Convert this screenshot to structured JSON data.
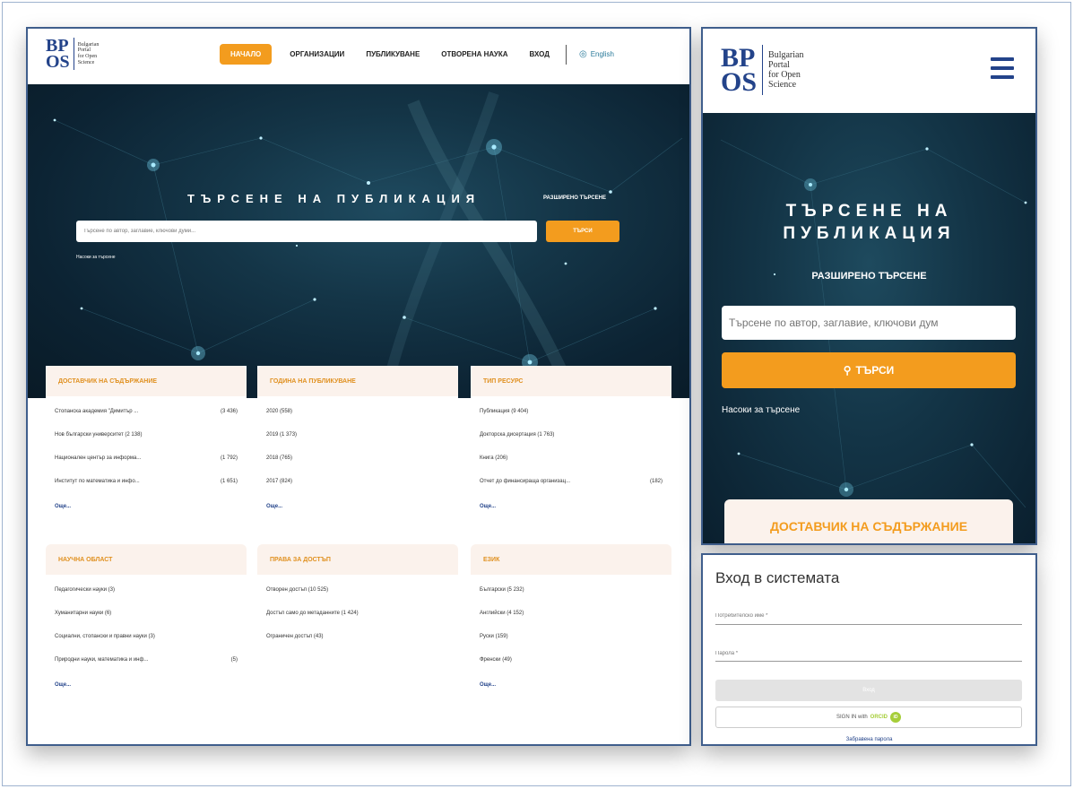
{
  "brand": {
    "mono_top": "BP",
    "mono_bottom": "OS",
    "line1": "Bulgarian",
    "line2": "Portal",
    "line3": "for Open",
    "line4": "Science"
  },
  "nav": {
    "items": [
      "НАЧАЛО",
      "ОРГАНИЗАЦИИ",
      "ПУБЛИКУВАНЕ",
      "ОТВОРЕНА НАУКА",
      "ВХОД"
    ],
    "lang": "English"
  },
  "hero": {
    "title": "ТЪРСЕНЕ НА ПУБЛИКАЦИЯ",
    "advanced": "РАЗШИРЕНО ТЪРСЕНЕ",
    "search_placeholder": "Търсене по автор, заглавие, ключови думи...",
    "search_button": "ТЪРСИ",
    "tips": "Насоки за търсене"
  },
  "facets": [
    {
      "title": "ДОСТАВЧИК НА СЪДЪРЖАНИЕ",
      "items": [
        {
          "label": "Стопанска академия \"Димитър ...",
          "count": "(3 436)"
        },
        {
          "label": "Нов български университет (2 138)",
          "count": ""
        },
        {
          "label": "Национален център за информа...",
          "count": "(1 792)"
        },
        {
          "label": "Институт по математика и инфо...",
          "count": "(1 651)"
        }
      ],
      "more": "Още..."
    },
    {
      "title": "ГОДИНА НА ПУБЛИКУВАНЕ",
      "items": [
        {
          "label": "2020 (558)",
          "count": ""
        },
        {
          "label": "2019 (1 373)",
          "count": ""
        },
        {
          "label": "2018 (765)",
          "count": ""
        },
        {
          "label": "2017 (824)",
          "count": ""
        }
      ],
      "more": "Още..."
    },
    {
      "title": "ТИП РЕСУРС",
      "items": [
        {
          "label": "Публикация (9 404)",
          "count": ""
        },
        {
          "label": "Докторска дисертация (1 763)",
          "count": ""
        },
        {
          "label": "Книга (206)",
          "count": ""
        },
        {
          "label": "Отчет до финансираща организац...",
          "count": "(182)"
        }
      ],
      "more": "Още..."
    },
    {
      "title": "НАУЧНА ОБЛАСТ",
      "items": [
        {
          "label": "Педагогически науки (3)",
          "count": ""
        },
        {
          "label": "Хуманитарни науки (6)",
          "count": ""
        },
        {
          "label": "Социални, стопански и правни науки (3)",
          "count": ""
        },
        {
          "label": "Природни науки, математика и инф...",
          "count": "(5)"
        }
      ],
      "more": "Още..."
    },
    {
      "title": "ПРАВА ЗА ДОСТЪП",
      "items": [
        {
          "label": "Отворен достъп (10 525)",
          "count": ""
        },
        {
          "label": "Достъп само до метаданните (1 424)",
          "count": ""
        },
        {
          "label": "Ограничен достъп (43)",
          "count": ""
        }
      ],
      "more": ""
    },
    {
      "title": "ЕЗИК",
      "items": [
        {
          "label": "Български (5 232)",
          "count": ""
        },
        {
          "label": "Английски (4 152)",
          "count": ""
        },
        {
          "label": "Руски (159)",
          "count": ""
        },
        {
          "label": "Френски (49)",
          "count": ""
        }
      ],
      "more": "Още..."
    }
  ],
  "mobile": {
    "title_line1": "ТЪРСЕНЕ НА",
    "title_line2": "ПУБЛИКАЦИЯ",
    "advanced": "РАЗШИРЕНО ТЪРСЕНЕ",
    "search_placeholder": "Търсене по автор, заглавие, ключови дум",
    "search_button": "ТЪРСИ",
    "tips": "Насоки за търсене",
    "provider_heading": "ДОСТАВЧИК НА СЪДЪРЖАНИЕ"
  },
  "login": {
    "title": "Вход в системата",
    "username_placeholder": "Потребителско име *",
    "password_placeholder": "Парола *",
    "login_button": "Вход",
    "orcid_prefix": "SIGN IN with",
    "orcid_word": "ORCID",
    "orcid_icon": "iD",
    "forgot": "Забравена парола"
  },
  "colors": {
    "accent": "#f39c1e",
    "brand": "#23438a",
    "hero_dark": "#0c2333",
    "facet_head_bg": "#fbf2ec"
  }
}
